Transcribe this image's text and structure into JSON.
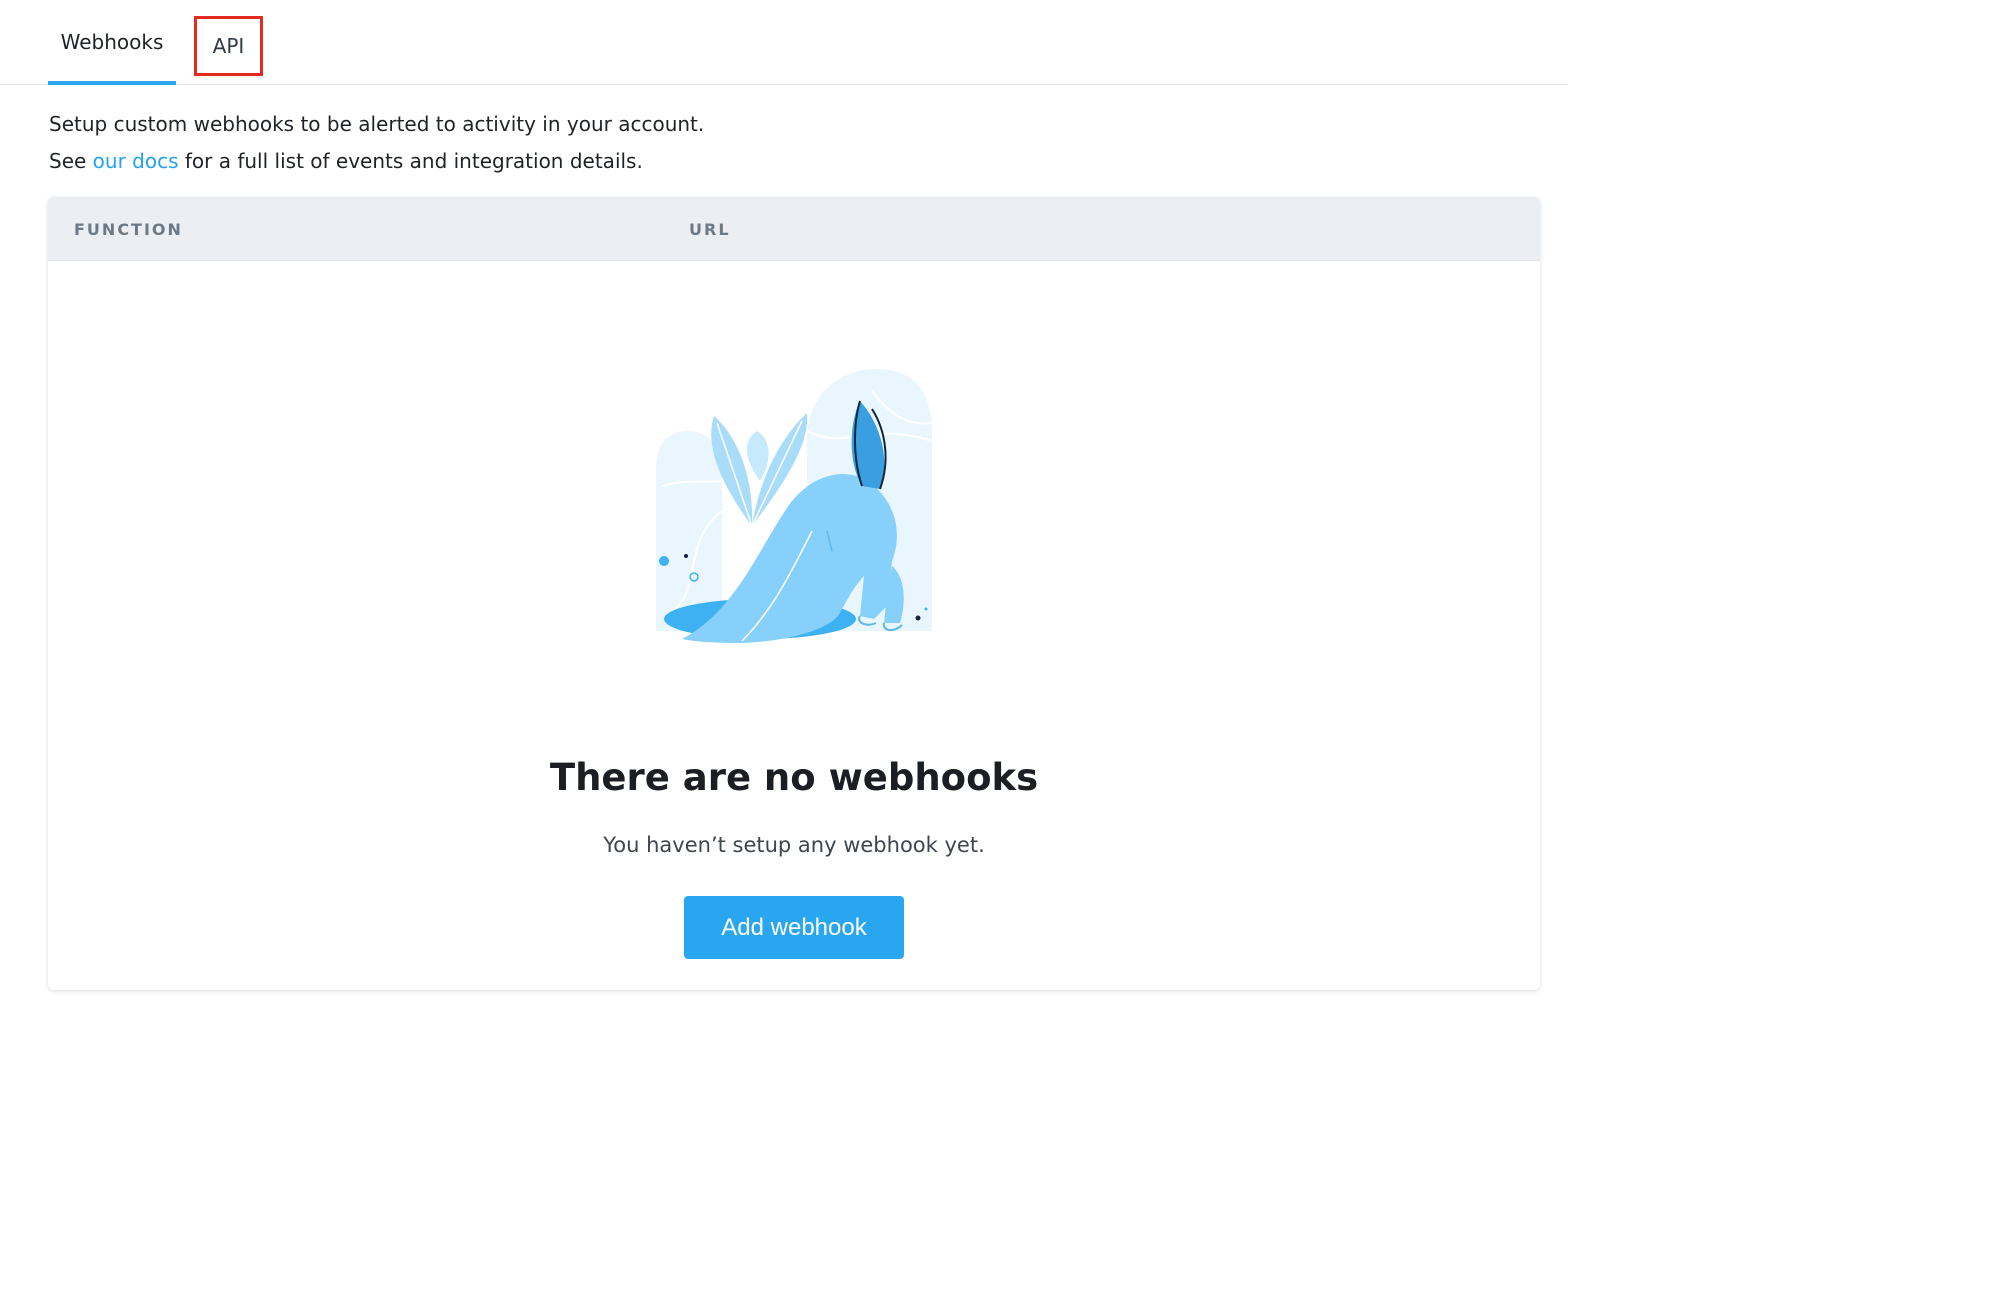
{
  "tabs": {
    "webhooks_label": "Webhooks",
    "api_label": "API"
  },
  "intro": {
    "line1": "Setup custom webhooks to be alerted to activity in your account.",
    "line2_prefix": "See ",
    "line2_link": "our docs",
    "line2_suffix": " for a full list of events and integration details."
  },
  "table": {
    "columns": [
      "FUNCTION",
      "URL"
    ]
  },
  "empty_state": {
    "illustration": "rabbit-digging-hole-illustration",
    "title": "There are no webhooks",
    "subtitle": "You haven’t setup any webhook yet.",
    "button_label": "Add webhook"
  },
  "colors": {
    "accent": "#29a6f0",
    "link": "#22a3f0",
    "highlight_box": "#e52b21",
    "header_bg": "#ebeef2"
  }
}
